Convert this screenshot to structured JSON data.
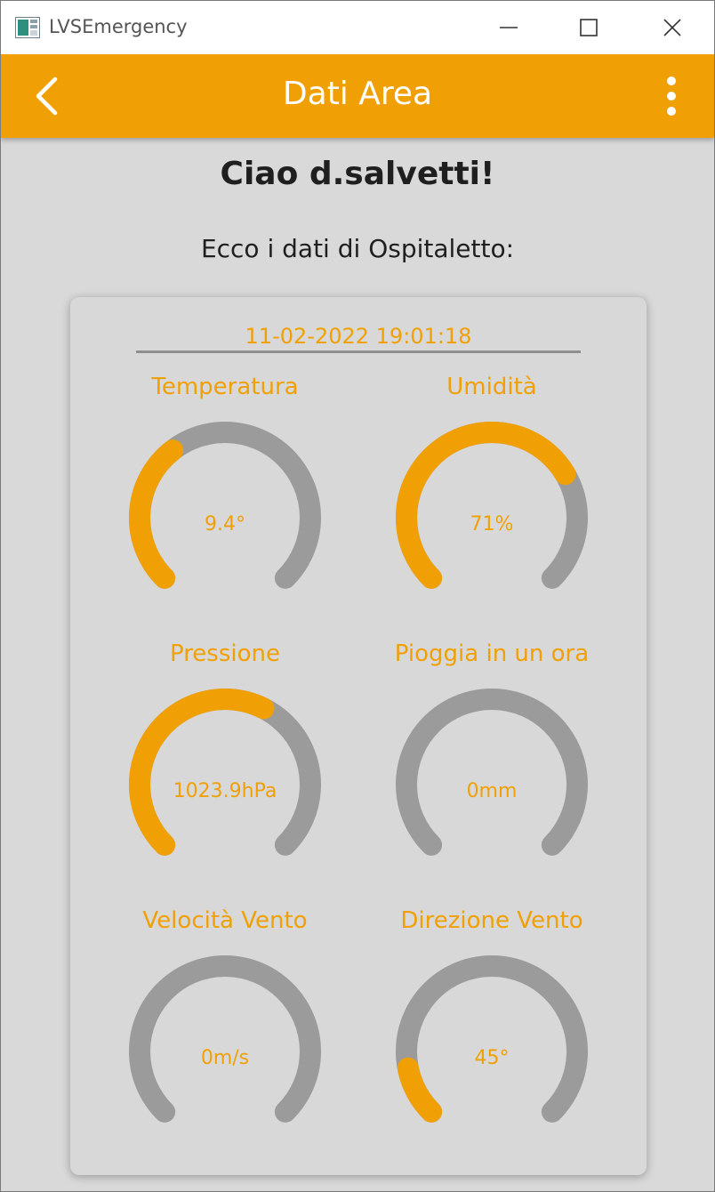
{
  "window": {
    "title": "LVSEmergency",
    "controls": {
      "minimize": "minimize-icon",
      "maximize": "maximize-icon",
      "close": "close-icon"
    }
  },
  "appbar": {
    "title": "Dati Area",
    "back_icon": "chevron-left-icon",
    "menu_icon": "more-vertical-icon"
  },
  "greeting": "Ciao d.salvetti!",
  "subtitle": "Ecco i dati di Ospitaletto:",
  "timestamp": "11-02-2022 19:01:18",
  "colors": {
    "accent": "#f0a005",
    "track": "#9b9b9b",
    "background": "#d9d9d9"
  },
  "gauges": [
    {
      "name": "Temperatura",
      "value": "9.4°",
      "fill_fraction": 0.36
    },
    {
      "name": "Umidità",
      "value": "71%",
      "fill_fraction": 0.72
    },
    {
      "name": "Pressione",
      "value": "1023.9hPa",
      "fill_fraction": 0.6
    },
    {
      "name": "Pioggia in un ora",
      "value": "0mm",
      "fill_fraction": 0
    },
    {
      "name": "Velocità Vento",
      "value": "0m/s",
      "fill_fraction": 0
    },
    {
      "name": "Direzione Vento",
      "value": "45°",
      "fill_fraction": 0.125
    }
  ]
}
